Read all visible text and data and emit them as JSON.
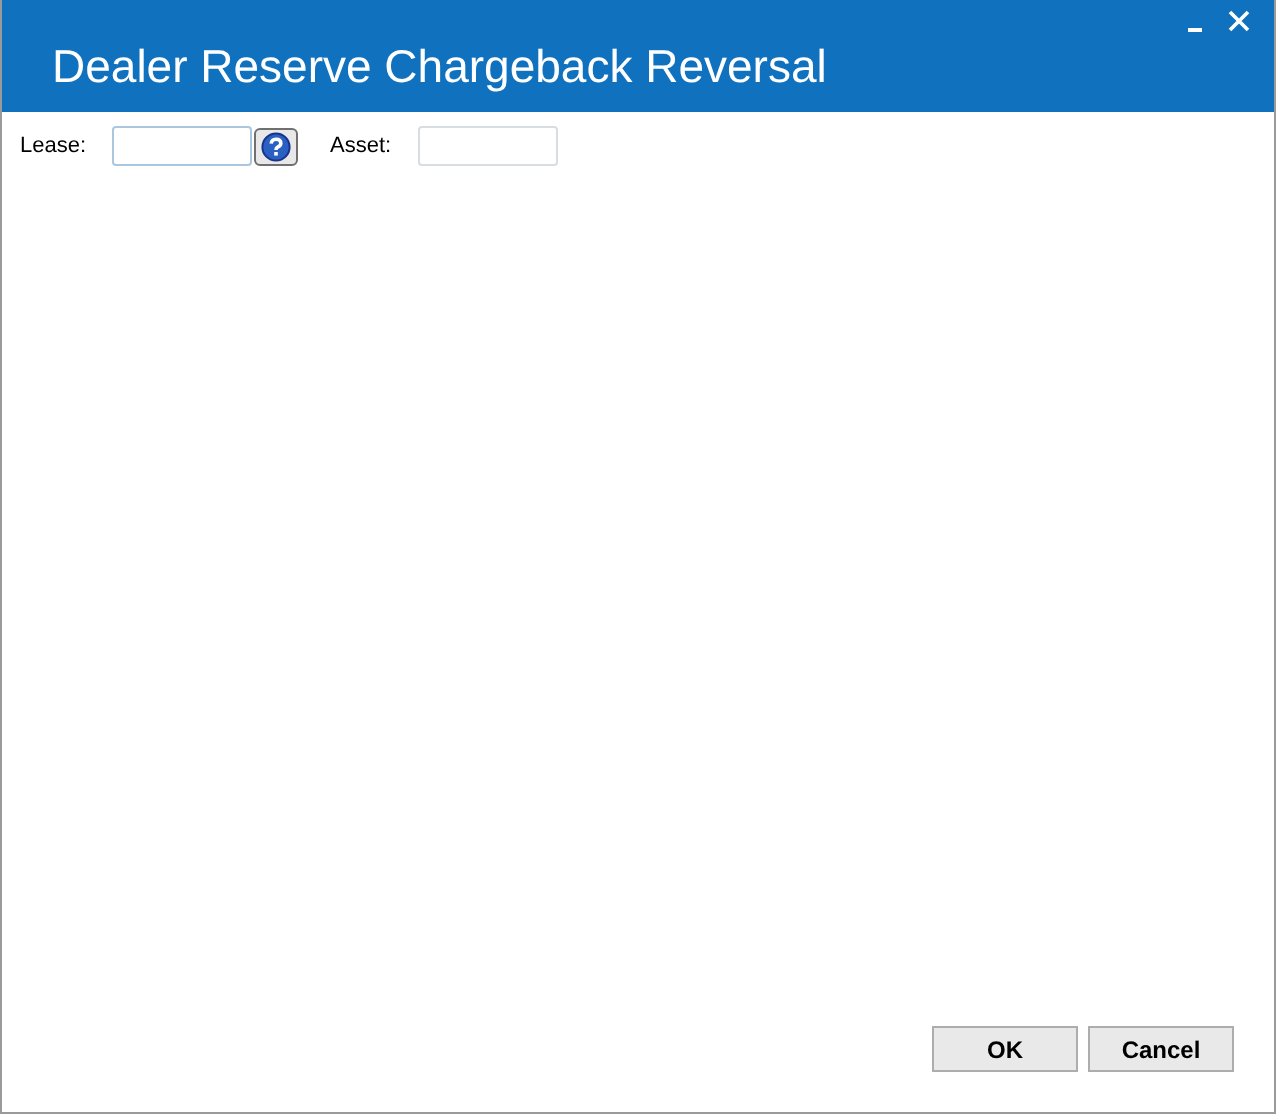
{
  "window": {
    "title": "Dealer Reserve Chargeback Reversal"
  },
  "fields": [
    {
      "label": "Lease:",
      "kind": "lookup"
    },
    {
      "label": "Asset:",
      "kind": "plain"
    }
  ],
  "buttons": [
    "OK",
    "Cancel"
  ]
}
